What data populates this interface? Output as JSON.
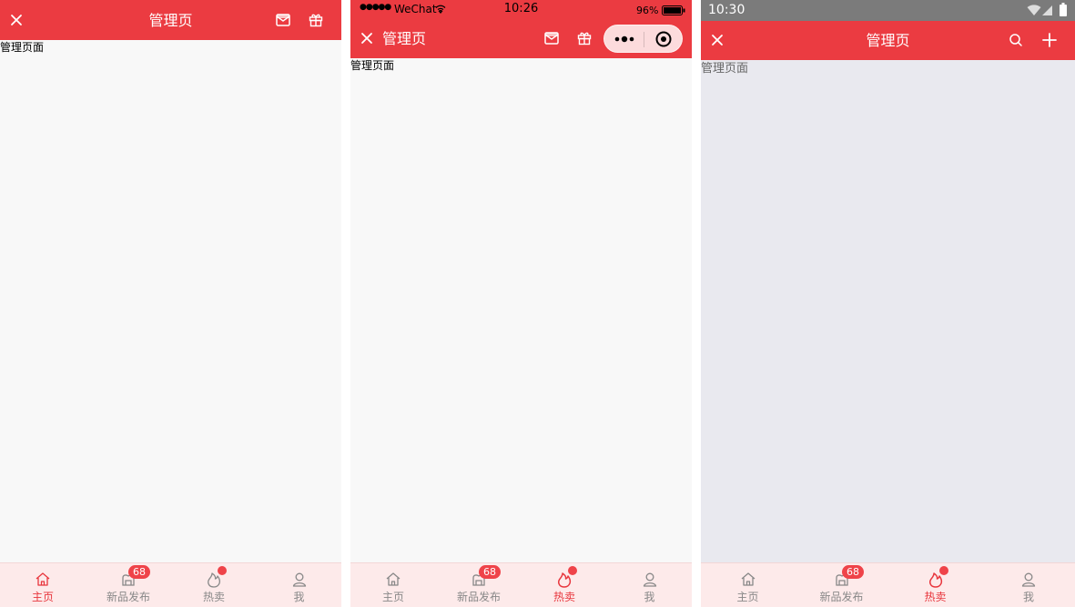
{
  "screens": [
    {
      "navbar": {
        "title": "管理页",
        "close_icon": "close-icon",
        "right_icons": [
          "red-packet-icon",
          "gift-icon"
        ]
      },
      "page_text": "管理页面",
      "tabbar": {
        "tabs": [
          {
            "label": "主页",
            "icon": "home-icon",
            "active": true
          },
          {
            "label": "新品发布",
            "icon": "new-product-icon",
            "badge": "68"
          },
          {
            "label": "热卖",
            "icon": "hot-sale-icon",
            "dot": true
          },
          {
            "label": "我",
            "icon": "user-icon"
          }
        ]
      }
    },
    {
      "statusbar": {
        "signal": "●●●●●",
        "carrier": "WeChat",
        "time": "10:26",
        "battery": "96%"
      },
      "navbar": {
        "title": "管理页",
        "close_icon": "close-icon",
        "right_icons": [
          "red-packet-icon",
          "gift-icon"
        ],
        "capsule_icons": [
          "more-icon",
          "target-icon"
        ]
      },
      "page_text": "管理页面",
      "tabbar": {
        "tabs": [
          {
            "label": "主页",
            "icon": "home-icon"
          },
          {
            "label": "新品发布",
            "icon": "new-product-icon",
            "badge": "68"
          },
          {
            "label": "热卖",
            "icon": "hot-sale-icon",
            "dot": true,
            "active": true
          },
          {
            "label": "我",
            "icon": "user-icon"
          }
        ]
      }
    },
    {
      "statusbar": {
        "time": "10:30",
        "icons": [
          "wifi-icon",
          "signal-icon",
          "battery-icon"
        ]
      },
      "navbar": {
        "title": "管理页",
        "close_icon": "close-icon",
        "right_icons": [
          "search-icon",
          "plus-icon"
        ]
      },
      "page_text": "管理页面",
      "tabbar": {
        "tabs": [
          {
            "label": "主页",
            "icon": "home-icon"
          },
          {
            "label": "新品发布",
            "icon": "new-product-icon",
            "badge": "68"
          },
          {
            "label": "热卖",
            "icon": "hot-sale-icon",
            "dot": true,
            "active": true
          },
          {
            "label": "我",
            "icon": "user-icon"
          }
        ]
      }
    }
  ],
  "colors": {
    "brand": "#eb3b41",
    "tab_active": "#e8363d",
    "tab_inactive": "#888888",
    "badge": "#ef4349",
    "tabbar_bg": "#fdeaea"
  }
}
